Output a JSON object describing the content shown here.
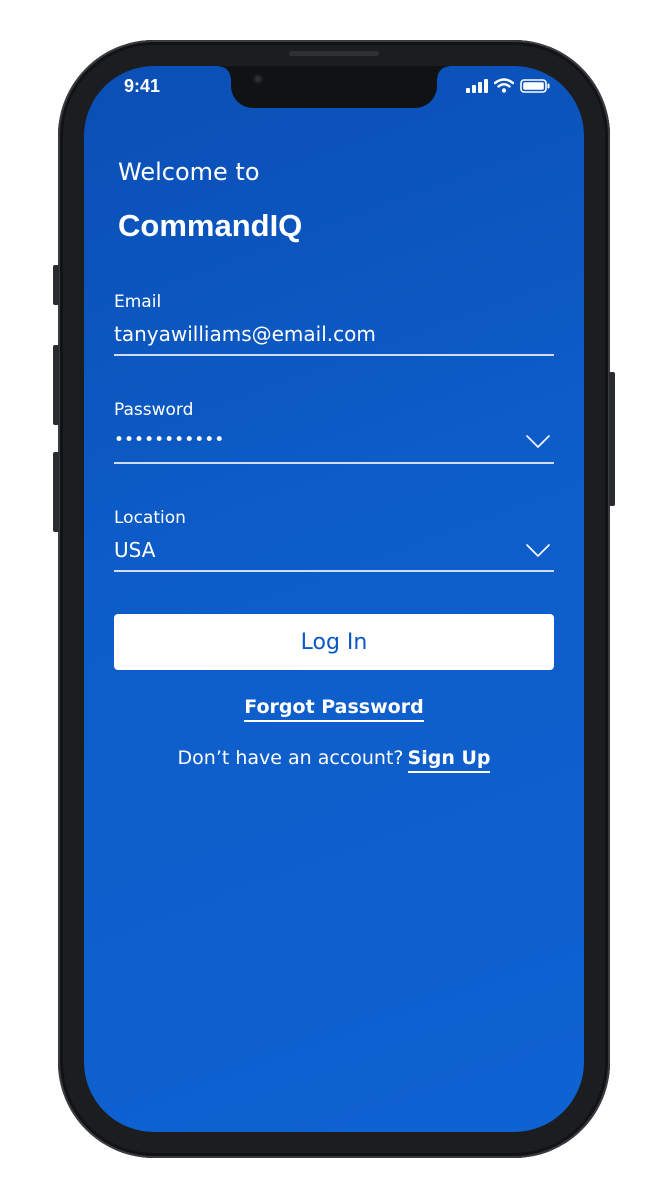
{
  "status_bar": {
    "time": "9:41"
  },
  "header": {
    "welcome": "Welcome to",
    "app_name": "CommandIQ"
  },
  "form": {
    "email": {
      "label": "Email",
      "value": "tanyawilliams@email.com"
    },
    "password": {
      "label": "Password",
      "value": "•••••••••••"
    },
    "location": {
      "label": "Location",
      "value": "USA"
    }
  },
  "actions": {
    "login_label": "Log In",
    "forgot_label": "Forgot Password",
    "no_account_text": "Don’t have an account?",
    "signup_label": "Sign Up"
  },
  "icons": {
    "signal": "cellular-signal-icon",
    "wifi": "wifi-icon",
    "battery": "battery-icon",
    "password_dropdown": "chevron-down-icon",
    "location_dropdown": "chevron-down-icon"
  },
  "colors": {
    "background": "#0d5dc9",
    "button_text": "#0d57c4"
  }
}
